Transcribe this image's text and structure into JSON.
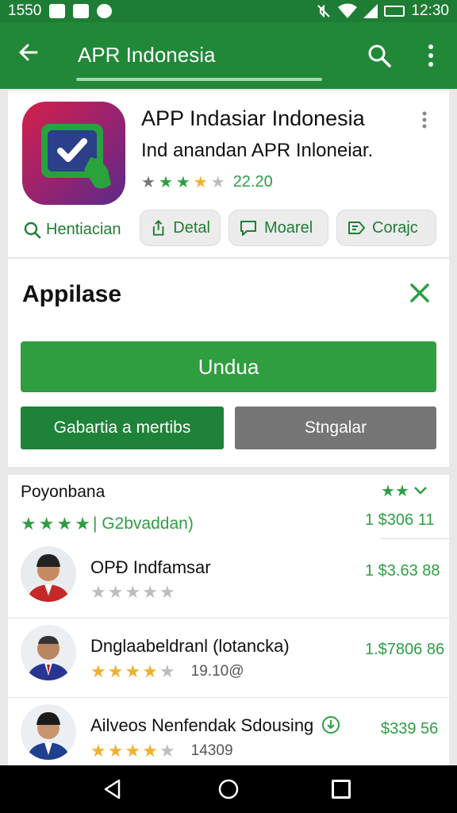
{
  "status_bar": {
    "left_time": "1550",
    "right_time": "12:30",
    "icons": [
      "image-icon",
      "message-icon",
      "notification-icon",
      "mute-icon",
      "wifi-icon",
      "signal-icon",
      "battery-icon"
    ]
  },
  "app_bar": {
    "title": "APR Indonesia",
    "icons": [
      "back-arrow-icon",
      "search-icon",
      "more-vert-icon"
    ]
  },
  "app_card": {
    "name": "APP Indasiar Indonesia",
    "subtitle": "Ind anandan  APR  Inloneiar.",
    "rating_text": "22.20",
    "hint_label": "Hentiacian",
    "chips": [
      "Detal",
      "Moarel",
      "Corajc"
    ]
  },
  "install_card": {
    "title": "Appilase",
    "primary_label": "Undua",
    "secondary_label": "Gabartia a mertibs",
    "tertiary_label": "Stngalar"
  },
  "reviews": {
    "header": "Poyonbana",
    "summary_text": "| G2bvaddan)",
    "summary_value": "1 $306 11",
    "items": [
      {
        "name": "OPÐ Indfamsar",
        "count": "",
        "value": "1 $3.63 88"
      },
      {
        "name": "Dnglaabeldranl (lotancka)",
        "count": "19.10@",
        "value": "1.$7806 86"
      },
      {
        "name": "Ailveos Nenfendak Sdousing",
        "count": "14309",
        "value": "$339 56"
      }
    ]
  },
  "colors": {
    "primary_green": "#218838",
    "accent_green": "#2e9e44",
    "star_yellow": "#f0b030",
    "grey_button": "#757575"
  }
}
